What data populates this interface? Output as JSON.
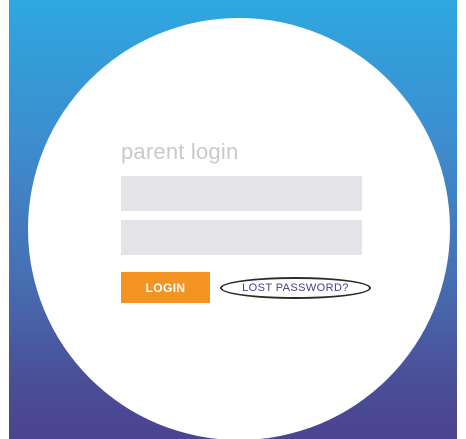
{
  "login": {
    "title": "parent login",
    "username": {
      "value": "",
      "placeholder": ""
    },
    "password": {
      "value": "",
      "placeholder": ""
    },
    "login_label": "LOGIN",
    "lost_password_label": "LOST PASSWORD?"
  },
  "colors": {
    "gradient_top": "#2ea7e0",
    "gradient_bottom": "#4b4390",
    "button_orange": "#f39322",
    "field_gray": "#e3e3e8",
    "title_gray": "#c9c9c9",
    "link_purple": "#4b3a8f"
  }
}
